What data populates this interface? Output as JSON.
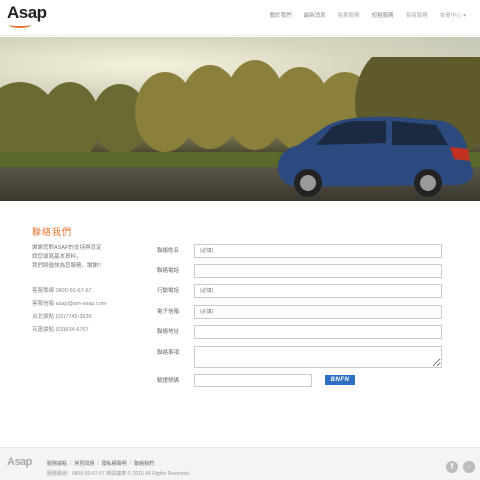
{
  "brand": {
    "logo": "Asap",
    "footer_logo": "Asap"
  },
  "nav": {
    "items": [
      {
        "label": "關於我們"
      },
      {
        "label": "最新消息"
      },
      {
        "label": "租車服務"
      },
      {
        "label": "短租服務"
      },
      {
        "label": "長租服務"
      },
      {
        "label": "會員中心 ▾"
      }
    ]
  },
  "contact": {
    "title": "聯絡我們",
    "intro": [
      "謝謝您對ASAP的支持與肯定",
      "請您填寫基本資料，",
      "我們將儘快為您服務，謝謝!!"
    ],
    "details": [
      "客服專線 0800-50-67-67",
      "客服信箱 asap@am-asap.com",
      "台北據點 (02)7745-3939",
      "花蓮據點 (03)834-6767"
    ]
  },
  "form": {
    "name": {
      "label": "聯絡姓名",
      "placeholder": "(必填)"
    },
    "phone": {
      "label": "聯絡電話",
      "placeholder": ""
    },
    "mobile": {
      "label": "行動電話",
      "placeholder": "(必填)"
    },
    "email": {
      "label": "電子信箱",
      "placeholder": "(必填)"
    },
    "address": {
      "label": "聯絡地址",
      "placeholder": ""
    },
    "message": {
      "label": "聯絡事項"
    },
    "captcha": {
      "label": "驗證號碼",
      "image_text": "BNFN"
    }
  },
  "footer": {
    "links": [
      "服務據點",
      "常見問題",
      "隱私權聲明",
      "聯絡我們"
    ],
    "info": "服務專線：0800-50-67-67 新凱瑞車 © 2015 All Rights Reserved.",
    "social": [
      "facebook-icon",
      "line-icon"
    ]
  }
}
